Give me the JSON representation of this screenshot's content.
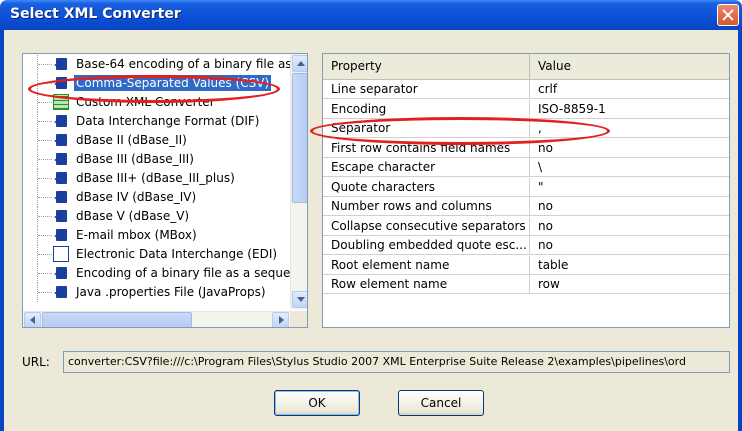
{
  "window": {
    "title": "Select XML Converter"
  },
  "converters": [
    {
      "label": "Base-64 encoding of a binary file as",
      "icon": "converter-icon"
    },
    {
      "label": "Comma-Separated Values (CSV)",
      "icon": "converter-icon",
      "selected": true
    },
    {
      "label": "Custom XML Converter",
      "icon": "grid-icon"
    },
    {
      "label": "Data Interchange Format (DIF)",
      "icon": "converter-icon"
    },
    {
      "label": "dBase II (dBase_II)",
      "icon": "converter-icon"
    },
    {
      "label": "dBase III (dBase_III)",
      "icon": "converter-icon"
    },
    {
      "label": "dBase III+ (dBase_III_plus)",
      "icon": "converter-icon"
    },
    {
      "label": "dBase IV (dBase_IV)",
      "icon": "converter-icon"
    },
    {
      "label": "dBase V (dBase_V)",
      "icon": "converter-icon"
    },
    {
      "label": "E-mail mbox (MBox)",
      "icon": "converter-icon"
    },
    {
      "label": "Electronic Data Interchange (EDI)",
      "icon": "edi-icon"
    },
    {
      "label": "Encoding of a binary file as a seque",
      "icon": "converter-icon"
    },
    {
      "label": "Java .properties File (JavaProps)",
      "icon": "converter-icon"
    }
  ],
  "properties": {
    "header_property": "Property",
    "header_value": "Value",
    "rows": [
      {
        "name": "Line separator",
        "value": "crlf"
      },
      {
        "name": "Encoding",
        "value": "ISO-8859-1"
      },
      {
        "name": "Separator",
        "value": ","
      },
      {
        "name": "First row contains field names",
        "value": "no"
      },
      {
        "name": "Escape character",
        "value": "\\"
      },
      {
        "name": "Quote characters",
        "value": "\""
      },
      {
        "name": "Number rows and columns",
        "value": "no"
      },
      {
        "name": "Collapse consecutive separators",
        "value": "no"
      },
      {
        "name": "Doubling embedded quote esc...",
        "value": "no"
      },
      {
        "name": "Root element name",
        "value": "table"
      },
      {
        "name": "Row element name",
        "value": "row"
      }
    ]
  },
  "url": {
    "label": "URL:",
    "value": "converter:CSV?file:///c:\\Program Files\\Stylus Studio 2007 XML Enterprise Suite Release 2\\examples\\pipelines\\ord"
  },
  "buttons": {
    "ok": "OK",
    "cancel": "Cancel"
  },
  "colors": {
    "title_bar": "#0a4fd6",
    "selection": "#316ac5",
    "highlight_oval": "#e32020"
  }
}
